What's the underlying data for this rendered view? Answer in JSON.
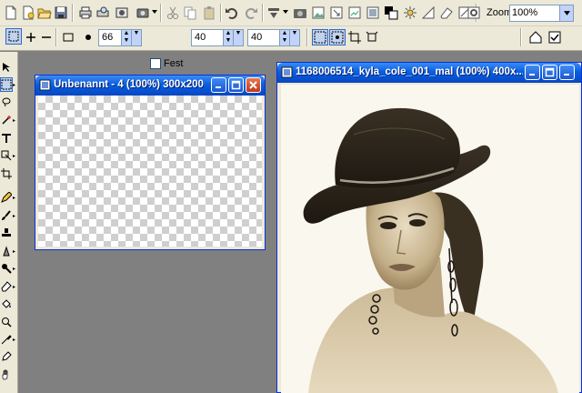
{
  "toolbar": {
    "zoom_label": "Zoom",
    "zoom_value": "100%",
    "icons": [
      "new-icon",
      "new-from-clipboard-icon",
      "open-icon",
      "save-icon",
      "print-icon",
      "print-preview-icon",
      "browse-icon",
      "cut-icon",
      "copy-icon",
      "paste-icon",
      "undo-icon",
      "redo-icon",
      "effects-icon",
      "camera-icon",
      "image-icon",
      "export-icon",
      "adjust-icon",
      "color-icon",
      "brightness-icon",
      "sharpen-icon",
      "erase-icon",
      "settings-icon"
    ]
  },
  "options_bar": {
    "size_value": "66",
    "fest_label": "Fest",
    "width_value": "40",
    "height_value": "40"
  },
  "windows": {
    "w1_title": "Unbenannt - 4 (100%) 300x200",
    "w2_title": "1168006514_kyla_cole_001_mal (100%) 400x..."
  },
  "colors": {
    "titlebar_blue": "#0a5fdf",
    "close_red": "#c1381b",
    "workspace_gray": "#808080",
    "toolbar_bg": "#ece9d8"
  }
}
